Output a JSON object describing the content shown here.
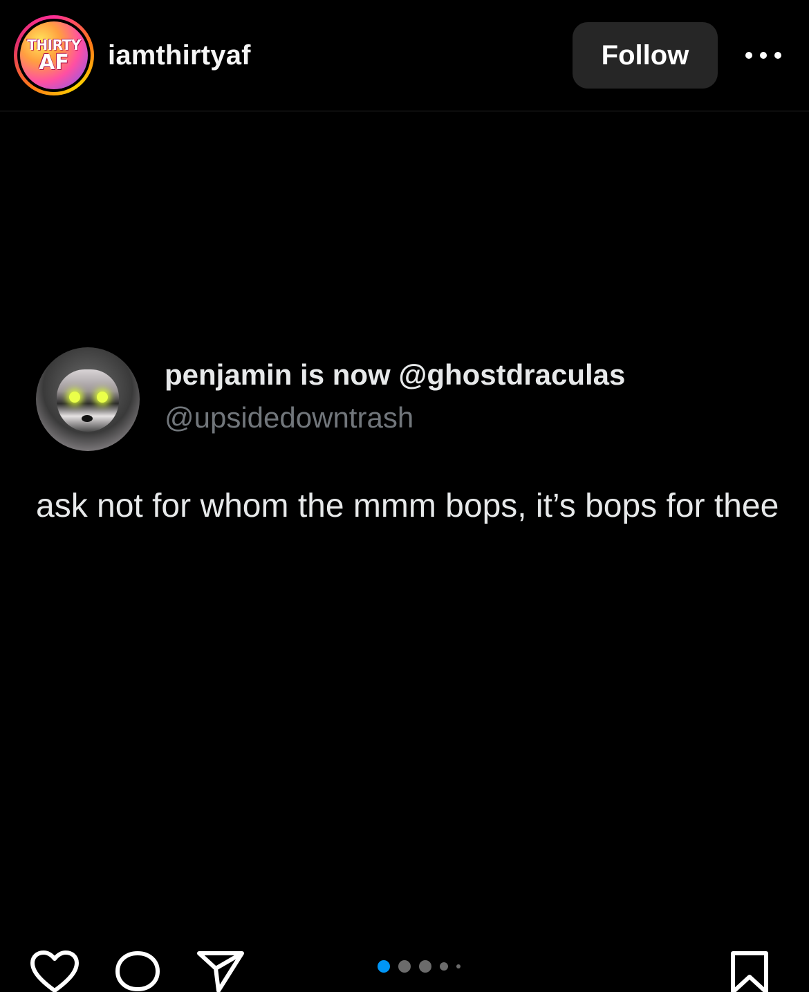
{
  "header": {
    "avatar_text_top": "THIRTY",
    "avatar_text_bottom": "AF",
    "username": "iamthirtyaf",
    "follow_label": "Follow",
    "more_icon": "more-horizontal-icon"
  },
  "post": {
    "tweet": {
      "display_name": "penjamin is now @ghostdraculas",
      "handle": "@upsidedowntrash",
      "text": "ask not for whom the mmm bops, it’s bops for thee"
    }
  },
  "actions": {
    "icons": [
      "heart-icon",
      "comment-icon",
      "share-icon",
      "bookmark-icon"
    ],
    "carousel": {
      "active_index": 0,
      "dot_count": 5,
      "active_color": "#0095f6"
    }
  },
  "colors": {
    "background": "#000000",
    "follow_button_bg": "#262626",
    "handle_gray": "#71767b",
    "accent_blue": "#0095f6"
  }
}
